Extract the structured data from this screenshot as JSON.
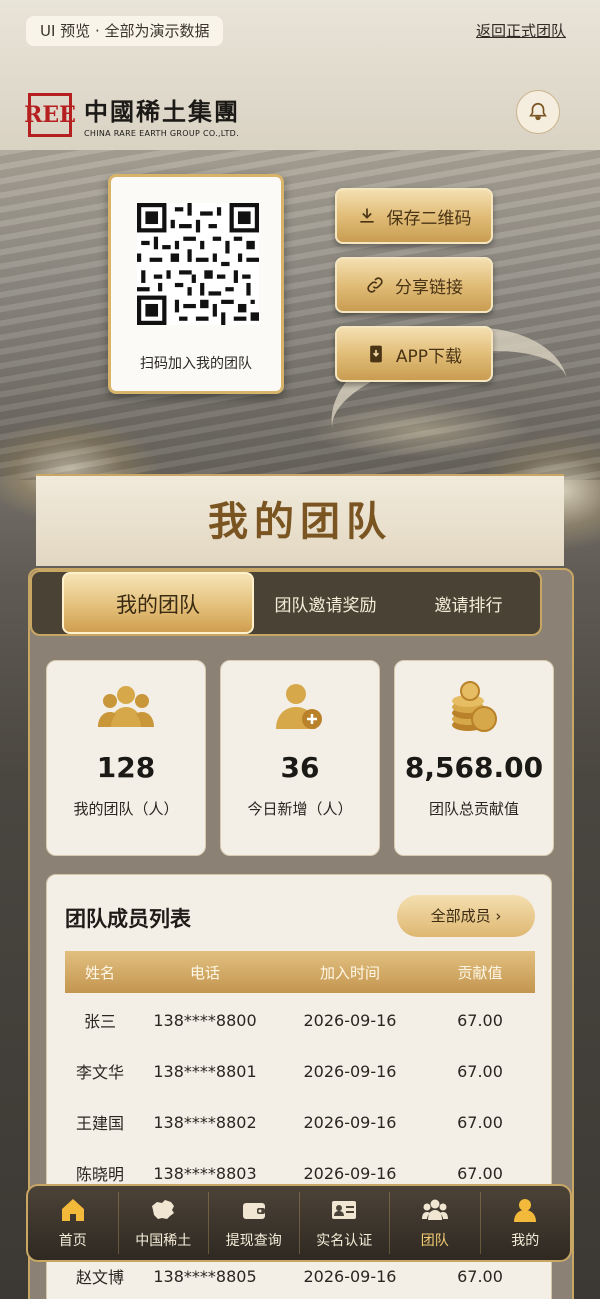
{
  "top": {
    "preview_badge": "UI 预览 · 全部为演示数据",
    "return_link": "返回正式团队"
  },
  "logo": {
    "mark": "REE",
    "cn": "中國稀土集團",
    "en": "CHINA RARE EARTH GROUP CO.,LTD."
  },
  "qr": {
    "caption": "扫码加入我的团队"
  },
  "actions": {
    "save_qr": "保存二维码",
    "share_link": "分享链接",
    "app_download": "APP下载"
  },
  "section_title": "我的团队",
  "tabs": [
    "我的团队",
    "团队邀请奖励",
    "邀请排行"
  ],
  "stats": [
    {
      "value": "128",
      "label": "我的团队（人）",
      "icon": "group-icon"
    },
    {
      "value": "36",
      "label": "今日新增（人）",
      "icon": "add-user-icon"
    },
    {
      "value": "8,568.00",
      "label": "团队总贡献值",
      "icon": "coins-icon"
    }
  ],
  "members": {
    "title": "团队成员列表",
    "all_button": "全部成员 ›",
    "headers": [
      "姓名",
      "电话",
      "加入时间",
      "贡献值"
    ],
    "rows": [
      [
        "张三",
        "138****8800",
        "2026-09-16",
        "67.00"
      ],
      [
        "李文华",
        "138****8801",
        "2026-09-16",
        "67.00"
      ],
      [
        "王建国",
        "138****8802",
        "2026-09-16",
        "67.00"
      ],
      [
        "陈晓明",
        "138****8803",
        "2026-09-16",
        "67.00"
      ],
      [
        "赵文博",
        "138****8805",
        "2026-09-16",
        "67.00"
      ]
    ]
  },
  "nav": [
    {
      "label": "首页",
      "icon": "home-icon"
    },
    {
      "label": "中国稀土",
      "icon": "china-map-icon"
    },
    {
      "label": "提现查询",
      "icon": "wallet-icon"
    },
    {
      "label": "实名认证",
      "icon": "id-card-icon"
    },
    {
      "label": "团队",
      "icon": "team-icon",
      "active": true
    },
    {
      "label": "我的",
      "icon": "profile-icon"
    }
  ],
  "colors": {
    "gold": "#d9b46c",
    "dark_panel": "#4b4236",
    "accent_text": "#7a5522"
  }
}
